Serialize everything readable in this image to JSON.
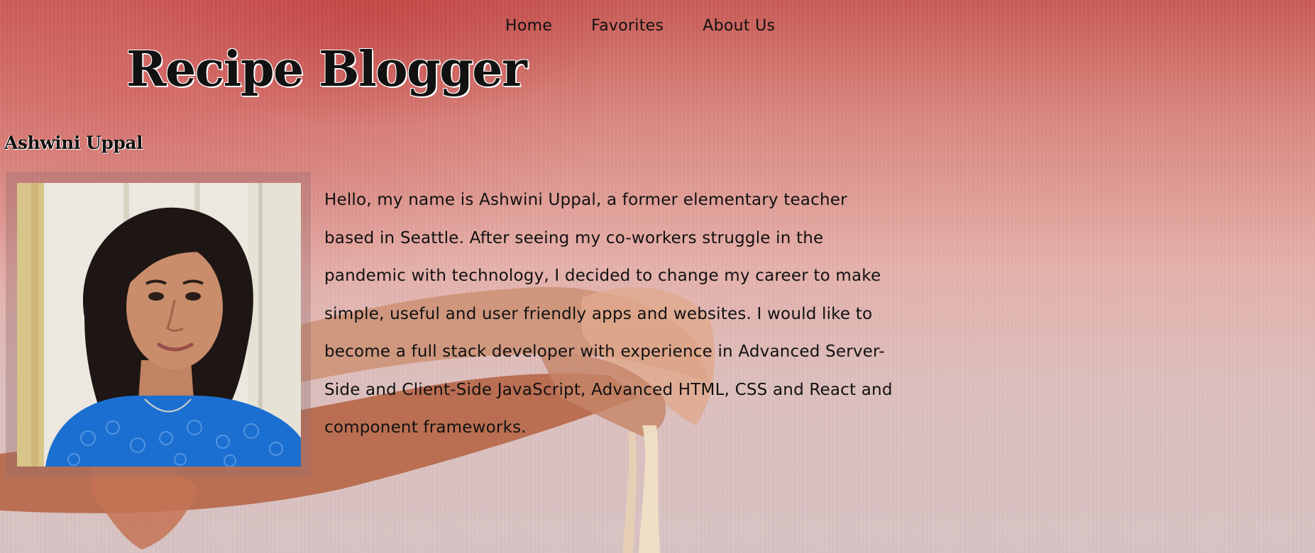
{
  "nav": {
    "items": [
      {
        "label": "Home"
      },
      {
        "label": "Favorites"
      },
      {
        "label": "About Us"
      }
    ]
  },
  "header": {
    "title": "Recipe Blogger"
  },
  "about": {
    "author_name": "Ashwini Uppal",
    "bio": "Hello, my name is Ashwini Uppal, a former elementary teacher based in Seattle. After seeing my co-workers struggle in the pandemic with technology, I decided to change my career to make simple, useful and user friendly apps and websites. I would like to become a full stack developer with experience in Advanced Server-Side and Client-Side JavaScript, Advanced HTML, CSS and React and component frameworks."
  },
  "colors": {
    "background_top": "#c85a55",
    "background_bottom": "#d8c2c3",
    "text": "#111111",
    "photo_shirt": "#1b6fd0"
  }
}
